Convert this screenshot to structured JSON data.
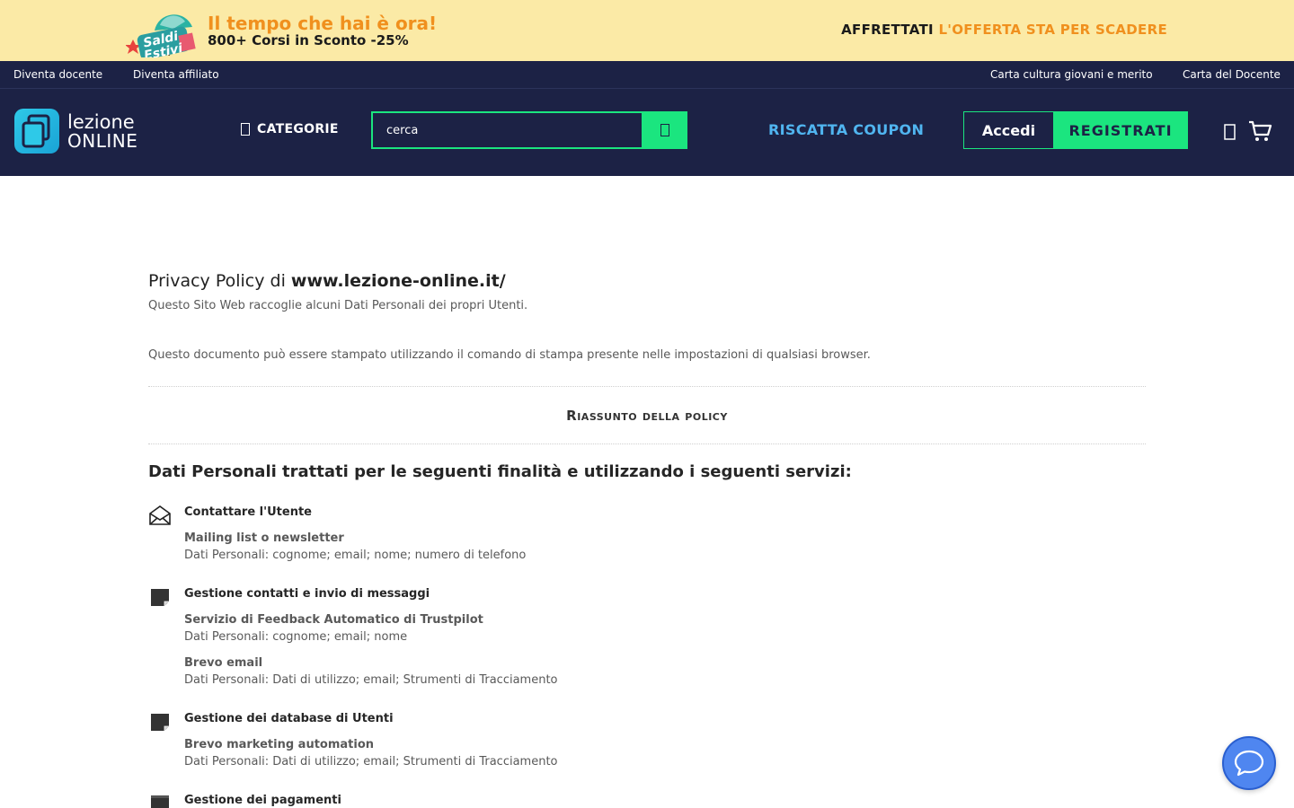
{
  "promo": {
    "badge_line1": "Saldi",
    "badge_line2": "Estivi",
    "headline": "Il tempo che hai è ora!",
    "subline": "800+ Corsi in Sconto -25%",
    "cta_dark": "AFFRETTATI",
    "cta_orange": "L'OFFERTA STA PER SCADERE",
    "colors": {
      "background": "#fbeaa6",
      "accent": "#f0901e"
    }
  },
  "topbar": {
    "links_left": [
      "Diventa docente",
      "Diventa affiliato"
    ],
    "links_right": [
      "Carta cultura giovani e merito",
      "Carta del Docente"
    ]
  },
  "header": {
    "logo_line1": "lezione",
    "logo_line2": "ONLINE",
    "categories_label": "CATEGORIE",
    "search_placeholder": "cerca",
    "search_icon": "search-icon",
    "coupon_label": "RISCATTA COUPON",
    "login_label": "Accedi",
    "register_label": "REGISTRATI",
    "wishlist_icon": "heart-icon",
    "cart_icon": "cart-icon",
    "colors": {
      "background": "#1c2245",
      "green": "#1be57f",
      "blue": "#50b5f0"
    }
  },
  "content": {
    "title_prefix": "Privacy Policy di",
    "title_site": "www.lezione-online.it/",
    "intro": "Questo Sito Web raccoglie alcuni Dati Personali dei propri Utenti.",
    "print_note": "Questo documento può essere stampato utilizzando il comando di stampa presente nelle impostazioni di qualsiasi browser.",
    "summary_heading": "Riassunto della policy",
    "section_heading": "Dati Personali trattati per le seguenti finalità e utilizzando i seguenti servizi:",
    "purposes": [
      {
        "title": "Contattare l'Utente",
        "icon": "envelope-icon",
        "services": [
          {
            "name": "Mailing list o newsletter",
            "data": "Dati Personali: cognome; email; nome; numero di telefono"
          }
        ]
      },
      {
        "title": "Gestione contatti e invio di messaggi",
        "icon": "note-icon",
        "services": [
          {
            "name": "Servizio di Feedback Automatico di Trustpilot",
            "data": "Dati Personali: cognome; email; nome"
          },
          {
            "name": "Brevo email",
            "data": "Dati Personali: Dati di utilizzo; email; Strumenti di Tracciamento"
          }
        ]
      },
      {
        "title": "Gestione dei database di Utenti",
        "icon": "note-icon",
        "services": [
          {
            "name": "Brevo marketing automation",
            "data": "Dati Personali: Dati di utilizzo; email; Strumenti di Tracciamento"
          }
        ]
      },
      {
        "title": "Gestione dei pagamenti",
        "icon": "wallet-icon",
        "services": []
      }
    ]
  },
  "chat": {
    "icon": "chat-bubble-icon",
    "color": "#4f86f0"
  }
}
